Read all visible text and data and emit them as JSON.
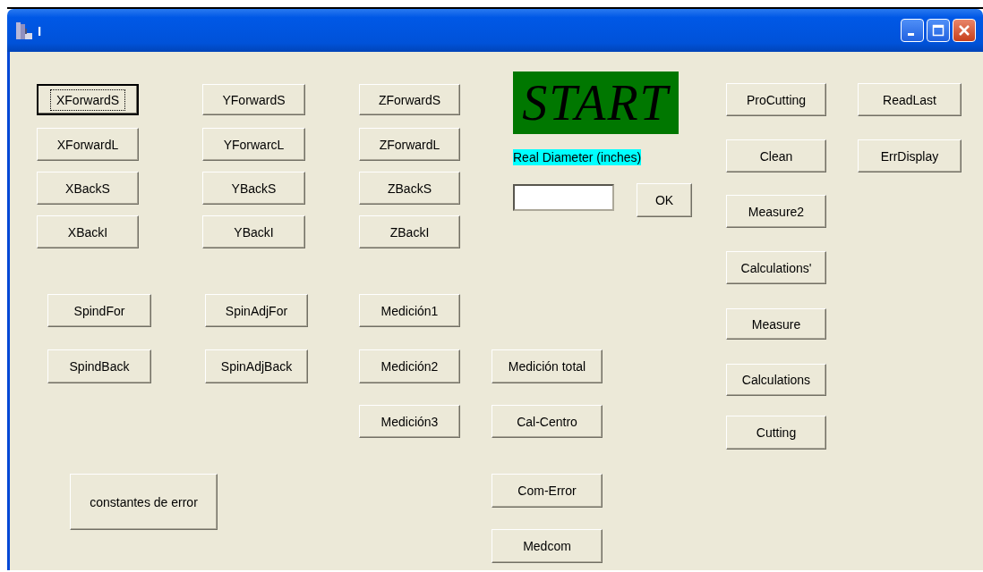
{
  "window": {
    "title": "I"
  },
  "start_label": "START",
  "diameter_label": "Real Diameter (inches)",
  "ok_button": {
    "label": "OK",
    "focused": false
  },
  "buttons": [
    {
      "label": "XForwardS",
      "focused": true
    },
    {
      "label": "YForwardS",
      "focused": false
    },
    {
      "label": "ZForwardS",
      "focused": false
    },
    {
      "label": "ProCutting",
      "focused": false
    },
    {
      "label": "ReadLast",
      "focused": false
    },
    {
      "label": "XForwardL",
      "focused": false
    },
    {
      "label": "YForwarcL",
      "focused": false
    },
    {
      "label": "ZForwardL",
      "focused": false
    },
    {
      "label": "Clean",
      "focused": false
    },
    {
      "label": "ErrDisplay",
      "focused": false
    },
    {
      "label": "XBackS",
      "focused": false
    },
    {
      "label": "YBackS",
      "focused": false
    },
    {
      "label": "ZBackS",
      "focused": false
    },
    {
      "label": "Measure2",
      "focused": false
    },
    {
      "label": "XBackI",
      "focused": false
    },
    {
      "label": "YBackI",
      "focused": false
    },
    {
      "label": "ZBackI",
      "focused": false
    },
    {
      "label": "Calculations'",
      "focused": false
    },
    {
      "label": "SpindFor",
      "focused": false
    },
    {
      "label": "SpinAdjFor",
      "focused": false
    },
    {
      "label": "Medición1",
      "focused": false
    },
    {
      "label": "Measure",
      "focused": false
    },
    {
      "label": "SpindBack",
      "focused": false
    },
    {
      "label": "SpinAdjBack",
      "focused": false
    },
    {
      "label": "Medición2",
      "focused": false
    },
    {
      "label": "Medición total",
      "focused": false
    },
    {
      "label": "Calculations",
      "focused": false
    },
    {
      "label": "Medición3",
      "focused": false
    },
    {
      "label": "Cal-Centro",
      "focused": false
    },
    {
      "label": "Cutting",
      "focused": false
    },
    {
      "label": "constantes de error",
      "focused": false
    },
    {
      "label": "Com-Error",
      "focused": false
    },
    {
      "label": "Medcom",
      "focused": false
    }
  ]
}
